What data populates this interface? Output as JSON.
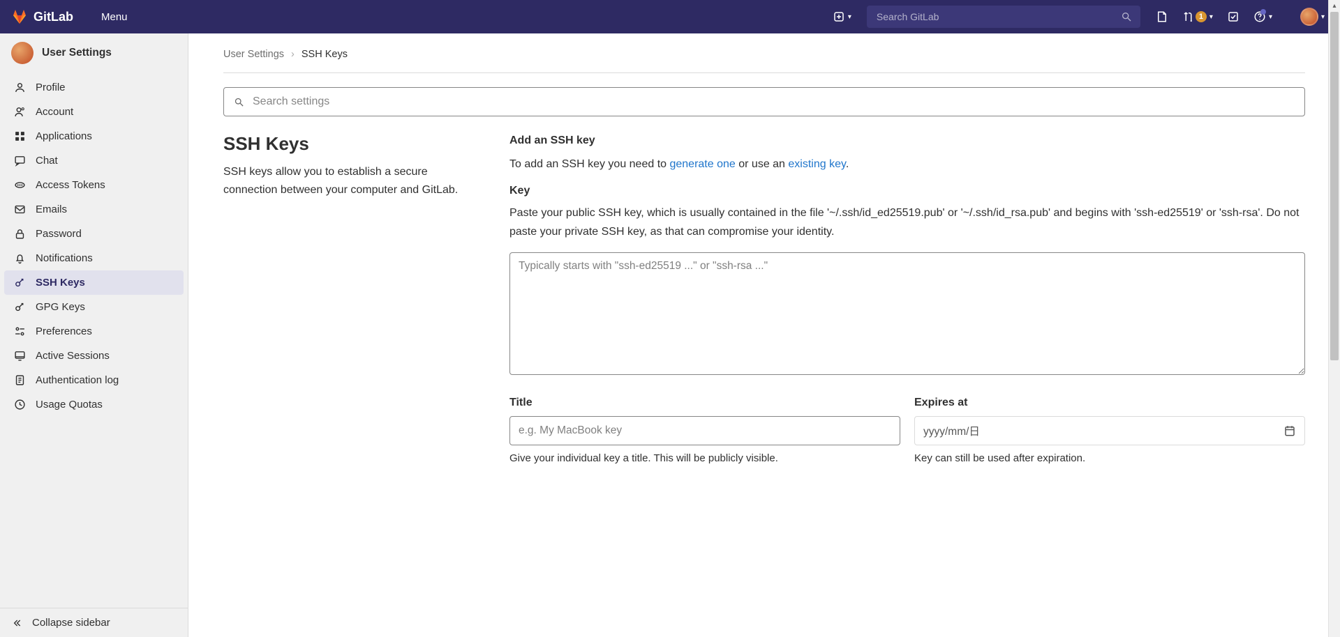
{
  "header": {
    "brand": "GitLab",
    "menu_label": "Menu",
    "search_placeholder": "Search GitLab",
    "mr_badge": "1"
  },
  "sidebar": {
    "context_title": "User Settings",
    "items": [
      {
        "label": "Profile"
      },
      {
        "label": "Account"
      },
      {
        "label": "Applications"
      },
      {
        "label": "Chat"
      },
      {
        "label": "Access Tokens"
      },
      {
        "label": "Emails"
      },
      {
        "label": "Password"
      },
      {
        "label": "Notifications"
      },
      {
        "label": "SSH Keys"
      },
      {
        "label": "GPG Keys"
      },
      {
        "label": "Preferences"
      },
      {
        "label": "Active Sessions"
      },
      {
        "label": "Authentication log"
      },
      {
        "label": "Usage Quotas"
      }
    ],
    "collapse_label": "Collapse sidebar"
  },
  "breadcrumb": {
    "a": "User Settings",
    "b": "SSH Keys"
  },
  "search_settings": {
    "placeholder": "Search settings"
  },
  "page": {
    "title": "SSH Keys",
    "subtitle": "SSH keys allow you to establish a secure connection between your computer and GitLab.",
    "add_heading": "Add an SSH key",
    "add_intro_pre": "To add an SSH key you need to ",
    "add_intro_link1": "generate one",
    "add_intro_mid": " or use an ",
    "add_intro_link2": "existing key",
    "add_intro_post": ".",
    "key_label": "Key",
    "key_help": "Paste your public SSH key, which is usually contained in the file '~/.ssh/id_ed25519.pub' or '~/.ssh/id_rsa.pub' and begins with 'ssh-ed25519' or 'ssh-rsa'. Do not paste your private SSH key, as that can compromise your identity.",
    "key_placeholder": "Typically starts with \"ssh-ed25519 ...\" or \"ssh-rsa ...\"",
    "title_label": "Title",
    "title_placeholder": "e.g. My MacBook key",
    "title_help": "Give your individual key a title. This will be publicly visible.",
    "expires_label": "Expires at",
    "expires_placeholder": "yyyy/mm/日",
    "expires_help": "Key can still be used after expiration."
  }
}
